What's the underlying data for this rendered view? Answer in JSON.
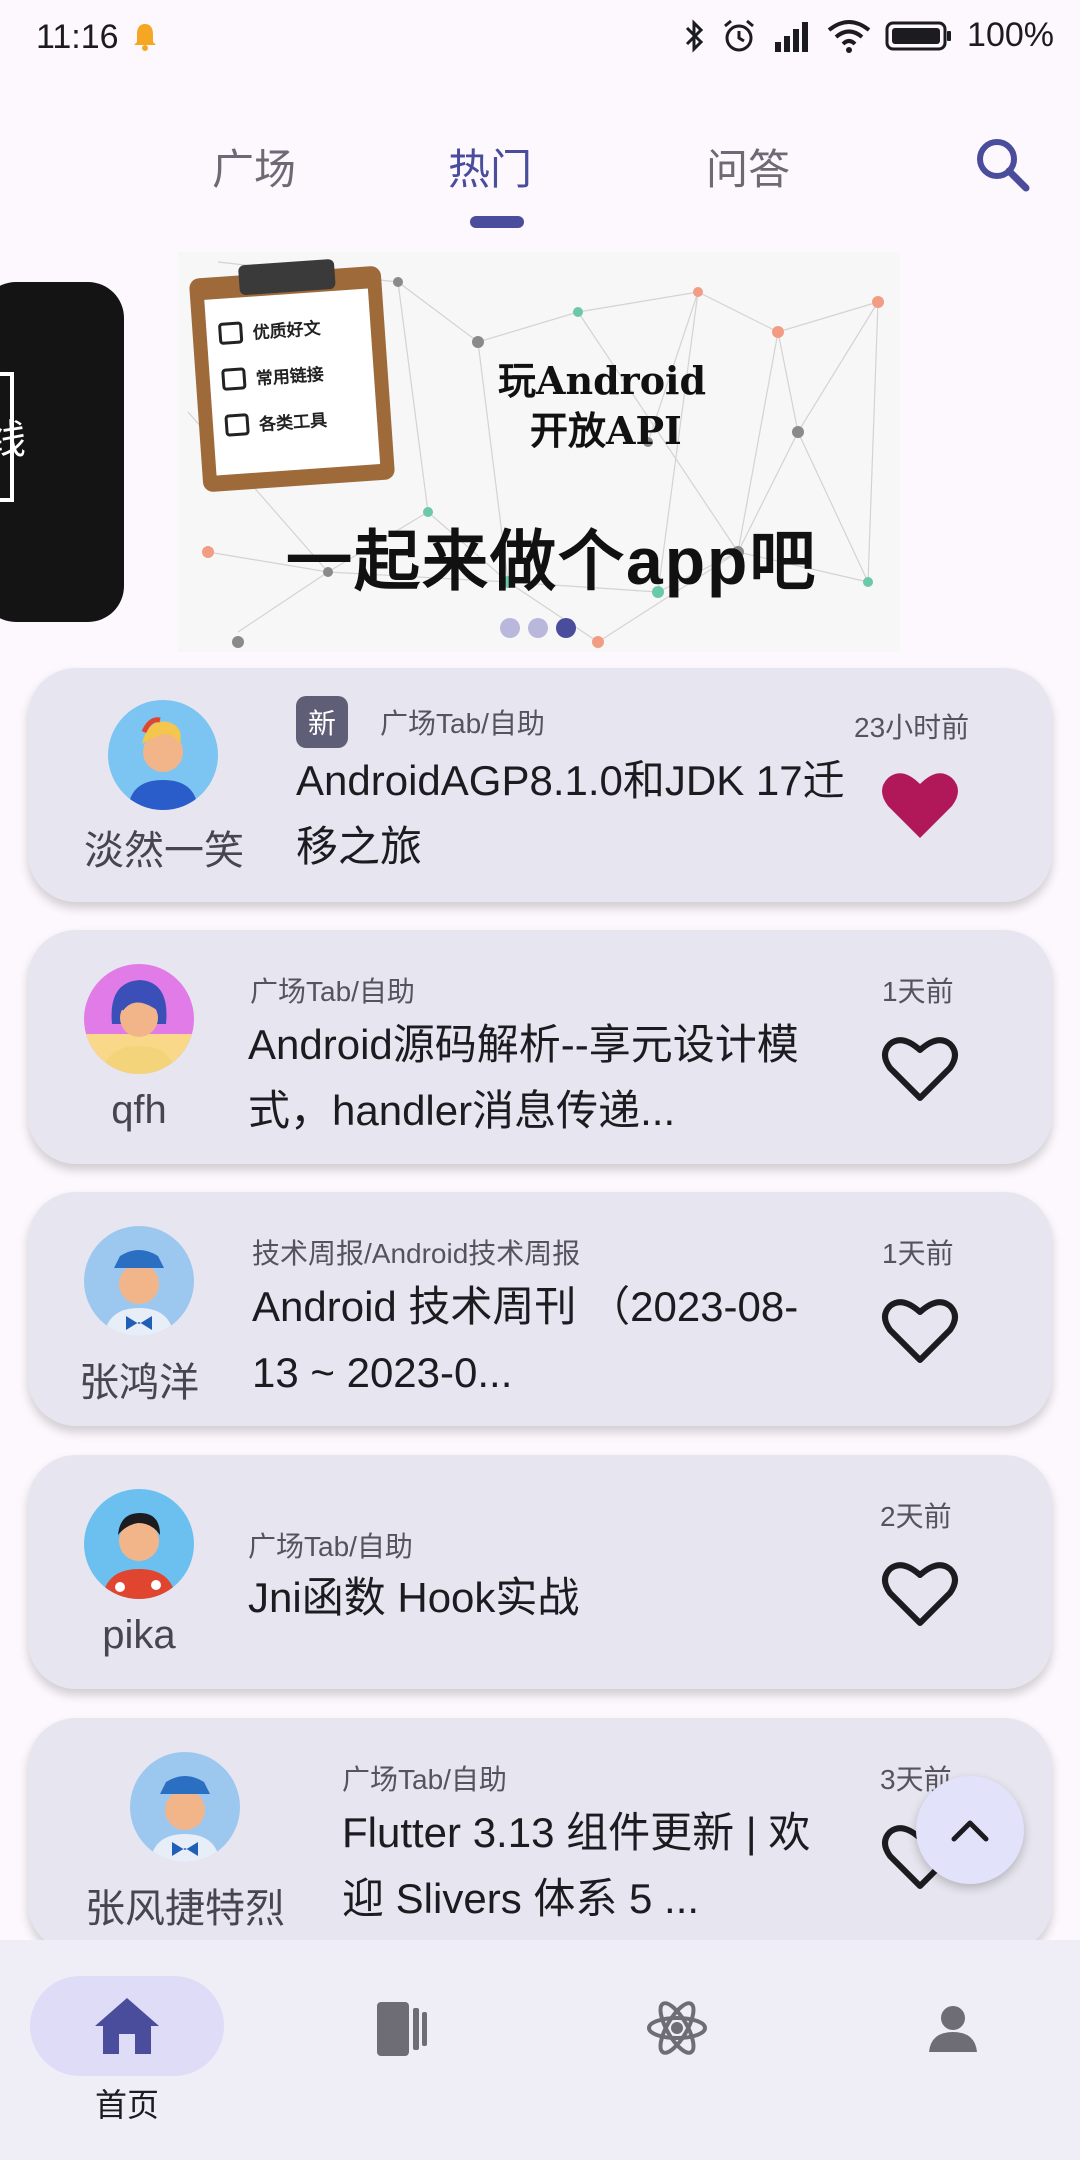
{
  "status_bar": {
    "time": "11:16",
    "battery": "100%"
  },
  "tabs": [
    {
      "label": "广场",
      "active": false
    },
    {
      "label": "热门",
      "active": true
    },
    {
      "label": "问答",
      "active": false
    }
  ],
  "banner": {
    "clipboard_items": [
      "优质好文",
      "常用链接",
      "各类工具"
    ],
    "title_line1": "玩Android",
    "title_line2": "开放API",
    "slogan": "一起来做个app吧",
    "side_text": "线",
    "page_index": 3,
    "page_count": 3
  },
  "articles": [
    {
      "author": "淡然一笑",
      "is_new": true,
      "new_label": "新",
      "chapter": "广场Tab/自助",
      "title": "AndroidAGP8.1.0和JDK 17迁移之旅",
      "time": "23小时前",
      "collected": true
    },
    {
      "author": "qfh",
      "is_new": false,
      "chapter": "广场Tab/自助",
      "title": "Android源码解析--享元设计模式，handler消息传递...",
      "time": "1天前",
      "collected": false
    },
    {
      "author": "张鸿洋",
      "is_new": false,
      "chapter": "技术周报/Android技术周报",
      "title": "Android 技术周刊 （2023-08-13 ~ 2023-0...",
      "time": "1天前",
      "collected": false
    },
    {
      "author": "pika",
      "is_new": false,
      "chapter": "广场Tab/自助",
      "title": "Jni函数 Hook实战",
      "time": "2天前",
      "collected": false
    },
    {
      "author": "张风捷特烈",
      "is_new": false,
      "chapter": "广场Tab/自助",
      "title": "Flutter 3.13 组件更新 | 欢迎 Slivers 体系 5 ...",
      "time": "3天前",
      "collected": false
    }
  ],
  "bottom_nav": [
    {
      "label": "首页",
      "icon": "home-icon",
      "active": true
    },
    {
      "label": "",
      "icon": "book-icon",
      "active": false
    },
    {
      "label": "",
      "icon": "atom-icon",
      "active": false
    },
    {
      "label": "",
      "icon": "person-icon",
      "active": false
    }
  ],
  "colors": {
    "accent": "#4a4c9c",
    "heart_filled": "#b0185a",
    "card_bg": "#e7e6f0"
  }
}
